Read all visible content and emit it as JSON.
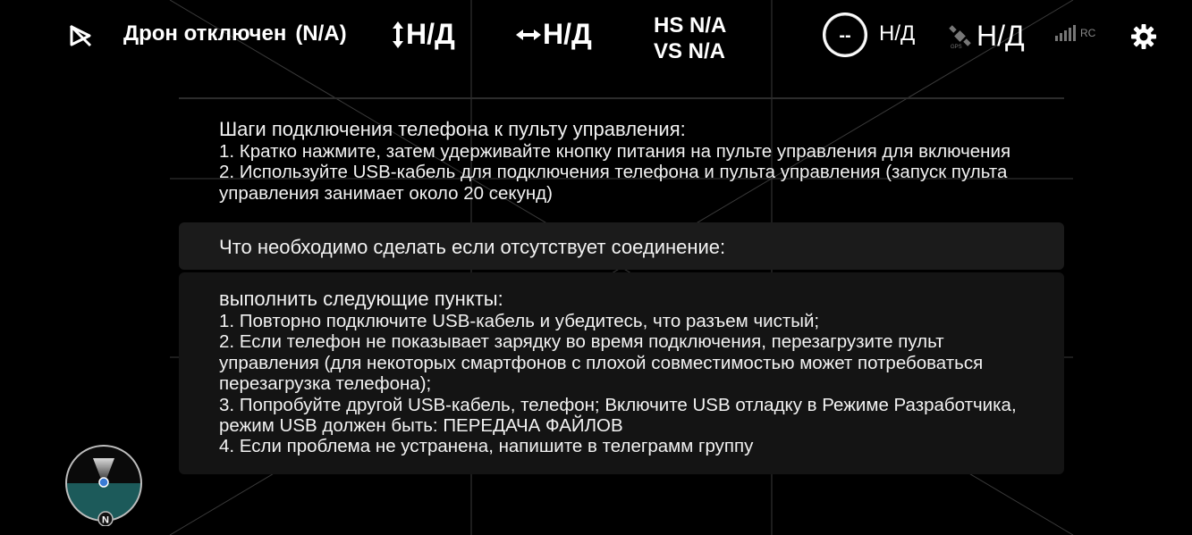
{
  "topbar": {
    "status": "Дрон отключен",
    "status_code": "(N/A)",
    "altitude": "Н/Д",
    "distance": "Н/Д",
    "hs": "HS N/A",
    "vs": "VS N/A",
    "battery_ring": "--",
    "battery_value": "Н/Д",
    "gps_value": "Н/Д",
    "rc_label": "RC"
  },
  "connection_steps": {
    "title": "Шаги подключения телефона к пульту управления:",
    "lines": [
      "1. Кратко нажмите, затем удерживайте кнопку питания на пульте управления для включения",
      "2. Используйте USB-кабель для подключения телефона и пульта управления (запуск пульта",
      "управления занимает около 20 секунд)"
    ]
  },
  "no_connection": {
    "title": "Что необходимо сделать если отсутствует соединение:"
  },
  "troubleshooting": {
    "title": "выполнить следующие пункты:",
    "lines": [
      "1. Повторно подключите USB-кабель и убедитесь, что разъем чистый;",
      "2. Если телефон не показывает зарядку во время подключения, перезагрузите пульт",
      "управления (для некоторых смартфонов с плохой совместимостью может потребоваться",
      "перезагрузка телефона);",
      "3. Попробуйте другой USB-кабель, телефон; Включите USB отладку в Режиме Разработчика,",
      "режим USB должен быть: ПЕРЕДАЧА ФАЙЛОВ",
      "4. Если проблема не устранена, напишите в телеграмм группу"
    ]
  },
  "compass": {
    "north_label": "N"
  },
  "icons": {
    "drone_off": "drone-off-icon",
    "altitude": "vertical-arrows-icon",
    "distance": "horizontal-arrows-icon",
    "gps": "satellite-icon",
    "signal": "signal-bars-icon",
    "settings": "gear-icon"
  },
  "colors": {
    "background": "#000000",
    "text": "#ffffff",
    "panel_dark": "#1b1b1b",
    "panel_darker": "#141414",
    "compass_ground": "#1c5a5a",
    "compass_dot": "#3a7bd5",
    "signal_muted": "#888888"
  }
}
